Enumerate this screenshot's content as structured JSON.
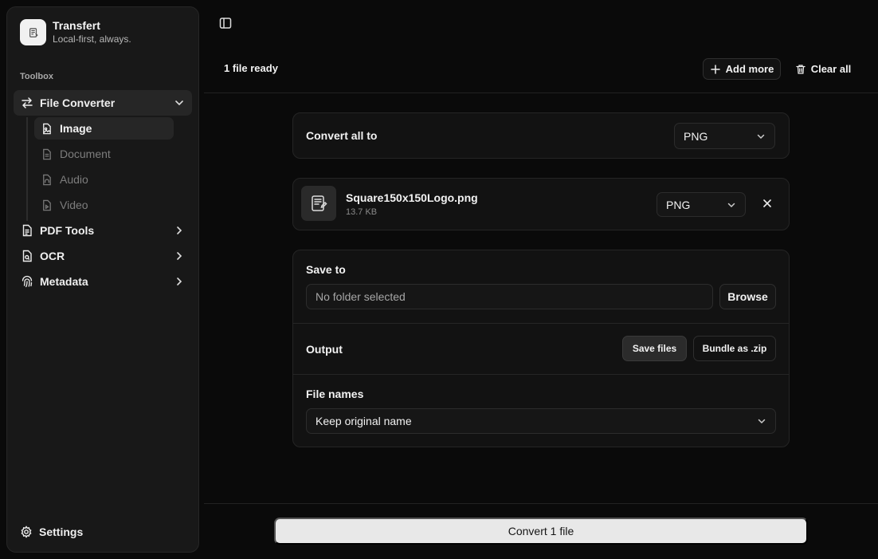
{
  "app": {
    "name": "Transfert",
    "tagline": "Local-first, always."
  },
  "sidebar": {
    "section_label": "Toolbox",
    "items": [
      {
        "label": "File Converter",
        "icon": "arrows-swap-icon",
        "active": true,
        "expanded": true
      },
      {
        "label": "PDF Tools",
        "icon": "file-text-icon"
      },
      {
        "label": "OCR",
        "icon": "file-scan-icon"
      },
      {
        "label": "Metadata",
        "icon": "fingerprint-icon"
      }
    ],
    "sub_items": [
      {
        "label": "Image",
        "icon": "file-image-icon",
        "active": true
      },
      {
        "label": "Document",
        "icon": "file-doc-icon"
      },
      {
        "label": "Audio",
        "icon": "file-audio-icon"
      },
      {
        "label": "Video",
        "icon": "file-video-icon"
      }
    ],
    "settings_label": "Settings"
  },
  "header": {
    "status": "1 file ready",
    "add_more": "Add more",
    "clear_all": "Clear all"
  },
  "convert_all": {
    "label": "Convert all to",
    "value": "PNG"
  },
  "file": {
    "name": "Square150x150Logo.png",
    "size": "13.7 KB",
    "format": "PNG"
  },
  "save": {
    "label": "Save to",
    "placeholder": "No folder selected",
    "browse": "Browse",
    "output_label": "Output",
    "save_files": "Save files",
    "bundle_zip": "Bundle as .zip",
    "file_names_label": "File names",
    "file_names_value": "Keep original name"
  },
  "primary_action": "Convert 1 file",
  "colors": {
    "primary_button": "#e8e8e8",
    "sidebar_bg": "#181818",
    "app_bg": "#0a0a0a"
  }
}
